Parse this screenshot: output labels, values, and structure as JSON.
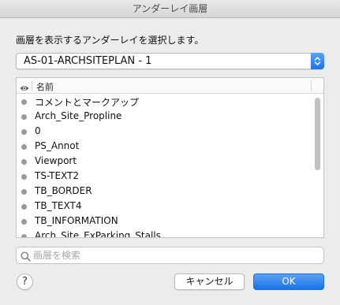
{
  "window": {
    "title": "アンダーレイ画層"
  },
  "prompt": "画層を表示するアンダーレイを選択します。",
  "underlay_select": {
    "value": "AS-01-ARCHSITEPLAN - 1"
  },
  "layer_list": {
    "column_visibility_icon": "eye-icon",
    "column_name": "名前",
    "rows": [
      {
        "name": "コメントとマークアップ"
      },
      {
        "name": "Arch_Site_Propline"
      },
      {
        "name": "0"
      },
      {
        "name": "PS_Annot"
      },
      {
        "name": "Viewport"
      },
      {
        "name": "TS-TEXT2"
      },
      {
        "name": "TB_BORDER"
      },
      {
        "name": "TB_TEXT4"
      },
      {
        "name": "TB_INFORMATION"
      },
      {
        "name": "Arch_Site_ExParking_Stalls"
      }
    ]
  },
  "search": {
    "placeholder": "画層を検索",
    "value": ""
  },
  "buttons": {
    "help": "?",
    "cancel": "キャンセル",
    "ok": "OK"
  },
  "colors": {
    "accent": "#1a72e8",
    "dot": "#9a9a9a"
  }
}
